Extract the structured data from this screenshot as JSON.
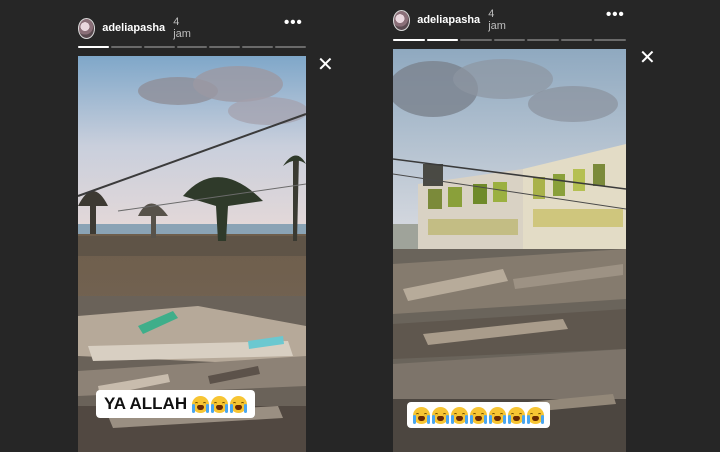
{
  "stories": [
    {
      "username": "adeliapasha",
      "time": "4 jam",
      "more_glyph": "•••",
      "close_glyph": "✕",
      "progress": [
        1,
        0,
        0,
        0,
        0,
        0,
        0
      ],
      "caption_text": "YA ALLAH",
      "caption_emoji_count": 3,
      "caption_emoji_name": "loudly-crying-face-icon"
    },
    {
      "username": "adeliapasha",
      "time": "4 jam",
      "more_glyph": "•••",
      "close_glyph": "✕",
      "progress": [
        1,
        1,
        0,
        0,
        0,
        0,
        0
      ],
      "caption_text": "",
      "caption_emoji_count": 7,
      "caption_emoji_name": "loudly-crying-face-icon"
    }
  ],
  "colors": {
    "background": "#262626",
    "progress_active": "#ffffff",
    "progress_inactive": "#6a6a6a"
  }
}
